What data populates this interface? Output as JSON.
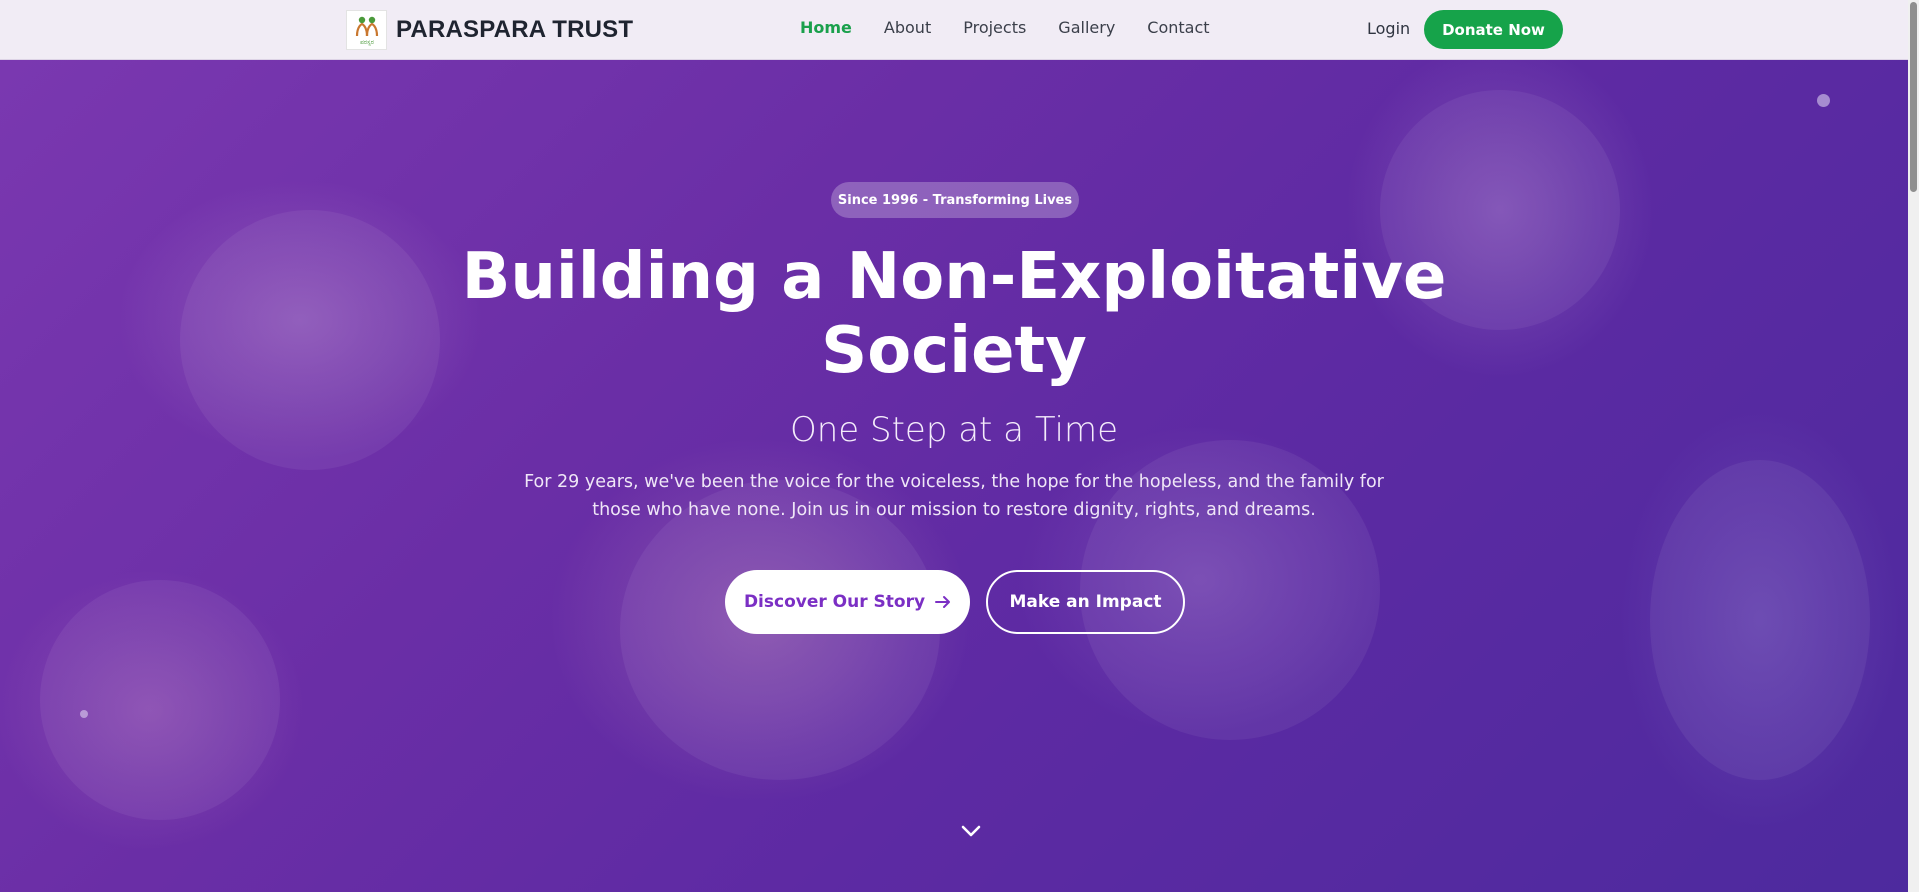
{
  "header": {
    "brand_name": "PARASPARA TRUST",
    "logo_text": "ಪರಸ್ಪರ",
    "nav": [
      {
        "label": "Home",
        "active": true
      },
      {
        "label": "About",
        "active": false
      },
      {
        "label": "Projects",
        "active": false
      },
      {
        "label": "Gallery",
        "active": false
      },
      {
        "label": "Contact",
        "active": false
      }
    ],
    "login_label": "Login",
    "donate_label": "Donate Now"
  },
  "hero": {
    "badge": "Since 1996 - Transforming Lives",
    "headline_line1": "Building a Non-Exploitative",
    "headline_line2": "Society",
    "subheadline": "One Step at a Time",
    "description_line1": "For 29 years, we've been the voice for the voiceless, the hope for the hopeless, and the family for",
    "description_line2": "those who have none. Join us in our mission to restore dignity, rights, and dreams.",
    "primary_button": "Discover Our Story",
    "secondary_button": "Make an Impact"
  },
  "colors": {
    "accent_green": "#16a34a",
    "hero_purple": "#6a2ea6",
    "primary_button_text": "#7b2fc4"
  },
  "icons": {
    "arrow": "arrow-right-icon",
    "scroll": "chevron-down-icon",
    "logo": "paraspara-logo"
  }
}
